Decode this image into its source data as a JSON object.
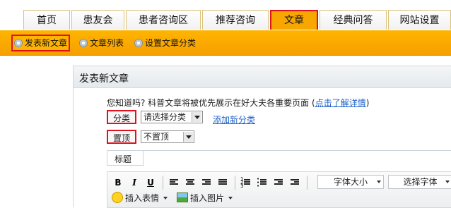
{
  "tabs": [
    {
      "label": "首页",
      "active": false
    },
    {
      "label": "患友会",
      "active": false
    },
    {
      "label": "患者咨询区",
      "active": false
    },
    {
      "label": "推荐咨询",
      "active": false
    },
    {
      "label": "文章",
      "active": true
    },
    {
      "label": "经典问答",
      "active": false
    },
    {
      "label": "网站设置",
      "active": false
    }
  ],
  "subnav": [
    {
      "label": "发表新文章",
      "active": true
    },
    {
      "label": "文章列表",
      "active": false
    },
    {
      "label": "设置文章分类",
      "active": false
    }
  ],
  "panel": {
    "title": "发表新文章",
    "notice_text": "您知道吗? 科普文章将被优先展示在好大夫各重要页面 (",
    "notice_link": "点击了解详情",
    "notice_end": ")"
  },
  "form": {
    "category_label": "分类",
    "category_value": "请选择分类",
    "add_category_link": "添加新分类",
    "pin_label": "置顶",
    "pin_value": "不置顶",
    "title_label": "标题",
    "title_value": ""
  },
  "editor": {
    "bold": "B",
    "italic": "I",
    "underline": "U",
    "font_size": "字体大小",
    "font_family": "选择字体",
    "insert_emoji": "插入表情",
    "insert_image": "插入图片"
  },
  "colors": {
    "accent_orange": "#f8a700",
    "highlight_red": "#e0121e",
    "link_blue": "#1f62c8"
  }
}
